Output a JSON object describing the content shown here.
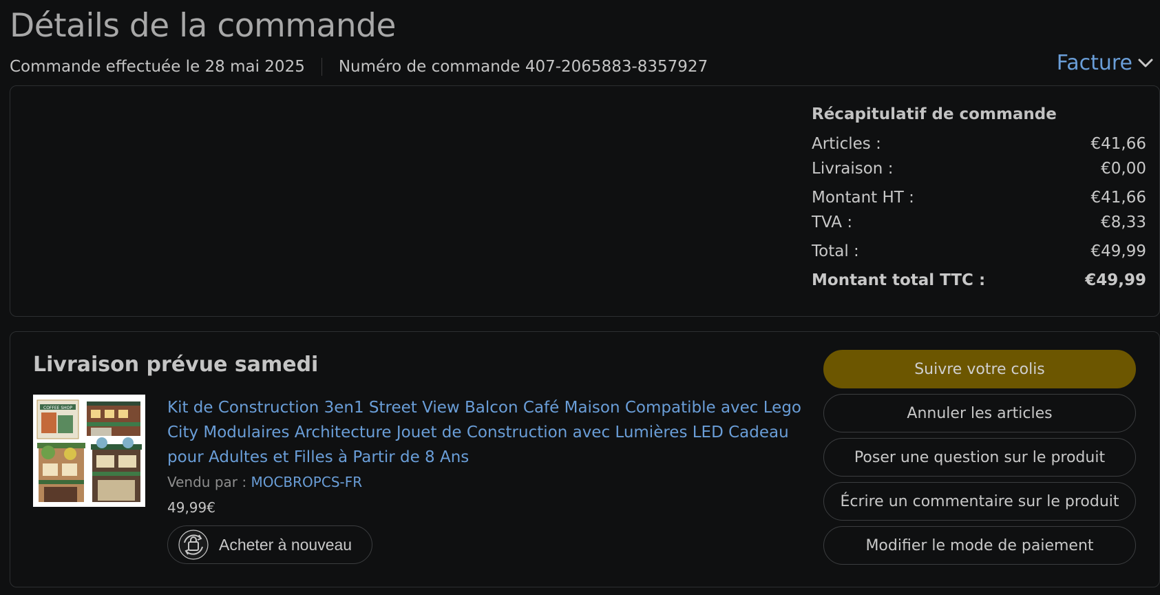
{
  "header": {
    "title": "Détails de la commande",
    "order_date": "Commande effectuée le 28 mai 2025",
    "order_number": "Numéro de commande 407-2065883-8357927",
    "invoice_label": "Facture",
    "invoice_icon": "chevron-down-icon"
  },
  "summary": {
    "title": "Récapitulatif de commande",
    "rows": [
      {
        "label": "Articles :",
        "value": "€41,66"
      },
      {
        "label": "Livraison :",
        "value": "€0,00"
      },
      {
        "label": "Montant HT :",
        "value": "€41,66"
      },
      {
        "label": "TVA :",
        "value": "€8,33"
      },
      {
        "label": "Total :",
        "value": "€49,99"
      }
    ],
    "grand_total_label": "Montant total TTC :",
    "grand_total_value": "€49,99"
  },
  "delivery": {
    "title": "Livraison prévue samedi",
    "product": {
      "title": "Kit de Construction 3en1 Street View Balcon Café Maison Compatible avec Lego City Modulaires Architecture Jouet de Construction avec Lumières LED Cadeau pour Adultes et Filles à Partir de 8 Ans",
      "sold_by_label": "Vendu par  :",
      "seller": "MOCBROPCS-FR",
      "price": "49,99€",
      "buy_again_label": "Acheter à nouveau",
      "buy_again_icon": "rebuy-icon",
      "image_caption": "COFFEE SHOP"
    },
    "actions": [
      {
        "label": "Suivre votre colis",
        "primary": true
      },
      {
        "label": "Annuler les articles"
      },
      {
        "label": "Poser une question sur le produit"
      },
      {
        "label": "Écrire un commentaire sur le produit"
      },
      {
        "label": "Modifier le mode de paiement"
      }
    ]
  },
  "colors": {
    "background": "#0f1011",
    "link": "#6a9ed8",
    "primary_button": "#6c5600"
  }
}
